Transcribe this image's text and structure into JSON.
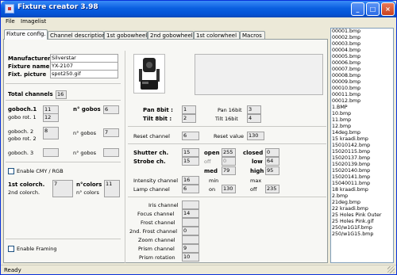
{
  "window": {
    "title": "Fixture creator 3.98",
    "min_glyph": "_",
    "max_glyph": "□",
    "close_glyph": "×"
  },
  "menu": {
    "items": [
      "File",
      "Imagelist"
    ]
  },
  "tabs": [
    "Fixture config.",
    "Channel description",
    "1st gobowheel",
    "2nd gobowheel",
    "1st colorwheel",
    "Macros"
  ],
  "fixture": {
    "manufacturer_label": "Manufacturer",
    "manufacturer_value": "Silverstar",
    "name_label": "Fixture name",
    "name_value": "YX-2107",
    "picture_label": "Fixt. picture",
    "picture_value": "spot250.gif"
  },
  "total_channels": {
    "label": "Total channels",
    "value": "16"
  },
  "gobos": {
    "goboch1_label": "goboch.1",
    "goboch1_value": "11",
    "gobo_rot1_label": "gobo rot. 1",
    "gobo_rot1_value": "12",
    "ngobos1_label": "n° gobos",
    "ngobos1_value": "6",
    "goboch2_label": "goboch. 2",
    "goboch2_value": "8",
    "gobo_rot2_label": "gobo rot. 2",
    "gobo_rot2_value": "",
    "ngobos2_label": "n° gobos",
    "ngobos2_value": "7",
    "goboch3_label": "goboch. 3",
    "goboch3_value": "",
    "ngobos3_label": "n° gobos",
    "ngobos3_value": ""
  },
  "cmy": {
    "enable_label": "Enable CMY / RGB"
  },
  "colors": {
    "colorch1_label": "1st colorch.",
    "colorch1_value": "7",
    "colorch2_label": "2nd colorch.",
    "colorch2_value": "",
    "ncolors_label": "n°colors",
    "ncolors_value": "11",
    "ncolors2_label": "n° colors",
    "ncolors2_value": ""
  },
  "framing": {
    "enable_label": "Enable Framing"
  },
  "pan_tilt": {
    "pan8_label": "Pan 8bit :",
    "pan8_value": "1",
    "tilt8_label": "Tilt 8bit :",
    "tilt8_value": "2",
    "pan16_label": "Pan 16bit",
    "pan16_value": "3",
    "tilt16_label": "Tilt 16bit",
    "tilt16_value": "4"
  },
  "reset": {
    "channel_label": "Reset channel",
    "channel_value": "6",
    "value_label": "Reset value",
    "value_value": "130"
  },
  "shutter": {
    "shutter_label": "Shutter ch.",
    "shutter_value": "15",
    "strobe_label": "Strobe ch.",
    "strobe_value": "15",
    "open_label": "open",
    "open_value": "255",
    "off_label": "off",
    "off_value": "0",
    "med_label": "med",
    "med_value": "79",
    "closed_label": "closed",
    "closed_value": "0",
    "low_label": "low",
    "low_value": "64",
    "high_label": "high",
    "high_value": "95"
  },
  "intensity": {
    "intensity_label": "Intensity channel",
    "intensity_value": "16",
    "lamp_label": "Lamp channel",
    "lamp_value": "6",
    "min_label": "min",
    "min_value": "",
    "max_label": "max",
    "max_value": "",
    "on_label": "on",
    "on_value": "130",
    "off_label": "off",
    "off_value": "235"
  },
  "misc_channels": [
    {
      "label": "Iris channel",
      "value": ""
    },
    {
      "label": "Focus channel",
      "value": "14"
    },
    {
      "label": "Frost channel",
      "value": ""
    },
    {
      "label": "2nd. Frost channel",
      "value": "0"
    },
    {
      "label": "Zoom channel",
      "value": ""
    },
    {
      "label": "Prism channel",
      "value": "9"
    },
    {
      "label": "Prism rotation",
      "value": "10"
    }
  ],
  "imagelist": [
    "00001.bmp",
    "00002.bmp",
    "00003.bmp",
    "00004.bmp",
    "00005.bmp",
    "00006.bmp",
    "00007.bmp",
    "00008.bmp",
    "00009.bmp",
    "00010.bmp",
    "00011.bmp",
    "00012.bmp",
    "1.BMP",
    "10.bmp",
    "11.bmp",
    "12.bmp",
    "14deg.bmp",
    "15 kraadi.bmp",
    "15010142.bmp",
    "15020115.bmp",
    "15020137.bmp",
    "15020139.bmp",
    "15020140.bmp",
    "15020141.bmp",
    "15040011.bmp",
    "18 kraadi.bmp",
    "2.bmp",
    "21deg.bmp",
    "22 kraadi.bmp",
    "25 Holes Pink Outer",
    "25 Holes Pink.gif",
    "250/w1G1F.bmp",
    "250/w1G15.bmp"
  ],
  "status": {
    "text": "Ready"
  }
}
